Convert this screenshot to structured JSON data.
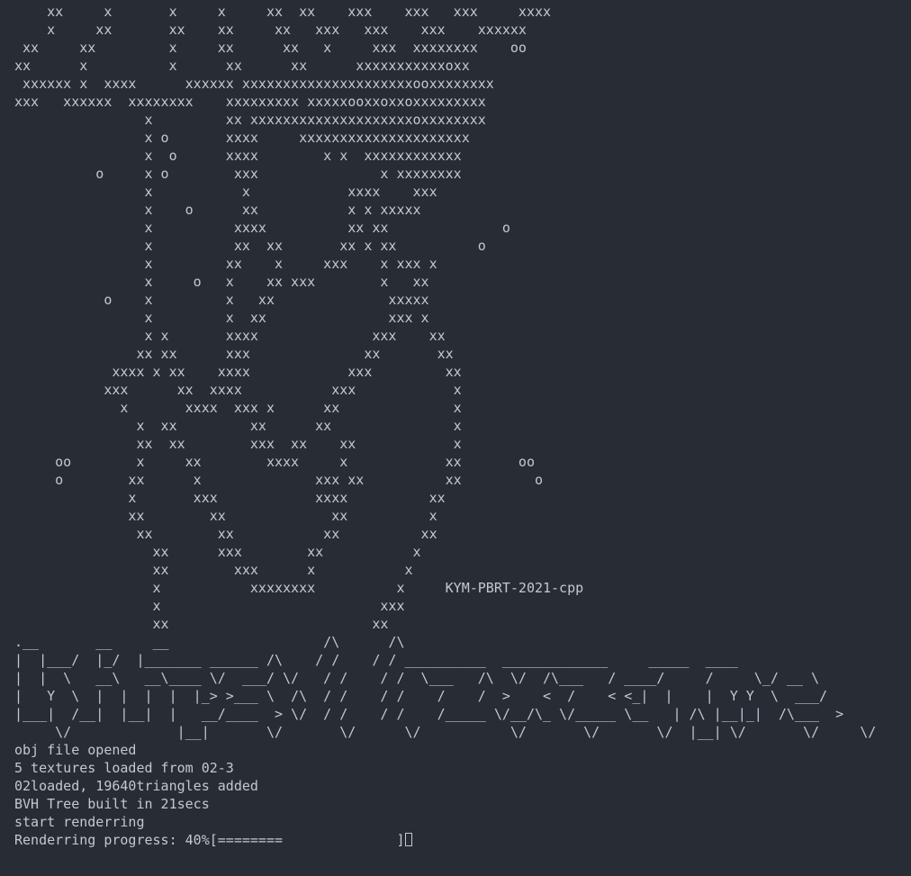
{
  "terminal": {
    "ascii_art": "    xx     x       x     x     xx  xx    xxx    xxx   xxx     xxxx\n    x     xx       xx    xx     xx   xxx   xxx    xxx    xxxxxx\n xx     xx         x     xx      xx   x     xxx  xxxxxxxx    oo\nxx      x          x      xx      xx      xxxxxxxxxxxoxx\n xxxxxx x  xxxx      xxxxxx xxxxxxxxxxxxxxxxxxxxxooxxxxxxxx\nxxx   xxxxxx  xxxxxxxx    xxxxxxxxx xxxxxooxxoxxoxxxxxxxxx\n                x         xx xxxxxxxxxxxxxxxxxxxxoxxxxxxxx\n                x o       xxxx     xxxxxxxxxxxxxxxxxxxxx\n                x  o      xxxx        x x  xxxxxxxxxxxx\n          o     x o        xxx               x xxxxxxxx\n                x           x            xxxx    xxx\n                x    o      xx           x x xxxxx\n                x          xxxx          xx xx              o\n                x          xx  xx       xx x xx          o\n                x         xx    x     xxx    x xxx x\n                x     o   x    xx xxx        x   xx\n           o    x         x   xx              xxxxx\n                x         x  xx               xxx x\n                x x       xxxx              xxx    xx\n               xx xx      xxx              xx       xx\n            xxxx x xx    xxxx            xxx         xx\n           xxx      xx  xxxx           xxx            x\n             x       xxxx  xxx x      xx              x\n               x  xx         xx      xx               x\n               xx  xx        xxx  xx    xx            x\n     oo        x     xx        xxxx     x            xx       oo\n     o        xx      x              xxx xx          xx         o\n              x       xxx            xxxx          xx\n              xx        xx             xx          x\n               xx        xx           xx          xx\n                 xx      xxx        xx           x\n                 xx        xxx      x           x\n                 x           xxxxxxxx          x     KYM-PBRT-2021-cpp\n                 x                           xxx\n                 xx                         xx",
    "banner_art": ".__       __     __                   /\\      /\\\n|  |___/  |_/  |_______ ______ /\\    / /    / / __________  _____________     _____  ____\n|  |  \\   __\\   __\\____ \\/  ___/ \\/   / /    / /  \\___   /\\  \\/  /\\___   / ____/     /     \\_/ __ \\\n|   Y  \\  |  |  |  |  |_> >___ \\  /\\  / /    / /    /    /  >    <  /    < <_|  |    |  Y Y  \\  ___/\n|___|  /__|  |__|  |   __/____  > \\/  / /    / /    /_____ \\/__/\\_ \\/_____ \\__   | /\\ |__|_|  /\\___  >\n     \\/             |__|       \\/       \\/      \\/           \\/       \\/       \\/  |__| \\/       \\/     \\/",
    "log_lines": [
      "obj file opened",
      "5 textures loaded from 02-3",
      "02loaded, 19640triangles added",
      "BVH Tree built in 21secs",
      "start renderring"
    ],
    "progress": {
      "text": "Renderring progress: 40%[========              ]",
      "percent": 40
    }
  }
}
